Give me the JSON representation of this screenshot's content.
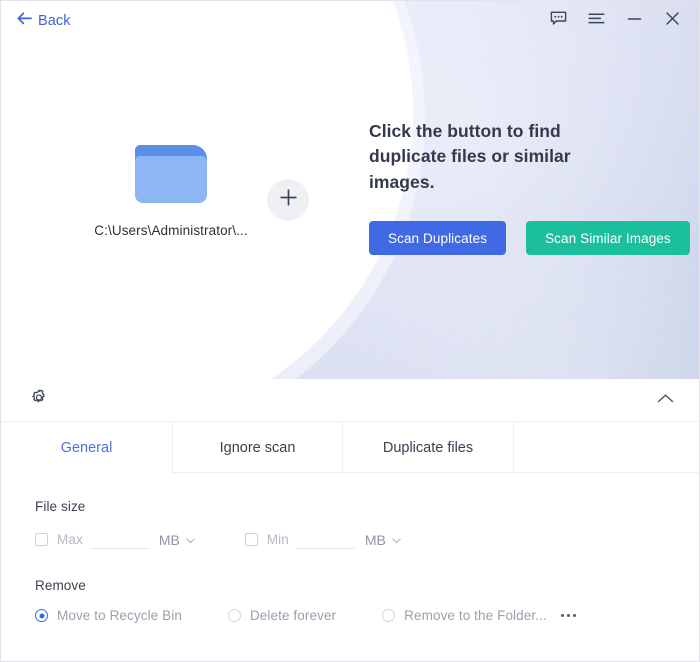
{
  "titlebar": {
    "back_label": "Back",
    "back_icon": "arrow-left-icon",
    "feedback_icon": "feedback-bubble-icon",
    "menu_icon": "hamburger-menu-icon",
    "minimize_icon": "minimize-icon",
    "close_icon": "close-icon"
  },
  "hero": {
    "folder_icon": "folder-icon",
    "folder_path": "C:\\Users\\Administrator\\...",
    "add_icon": "plus-icon",
    "heading": "Click the button to find duplicate files or similar images.",
    "buttons": {
      "scan_duplicates": "Scan Duplicates",
      "scan_similar": "Scan Similar Images"
    },
    "colors": {
      "primary": "#3f6ae4",
      "teal": "#1cbf9b",
      "folder_front": "#8eb6f5",
      "folder_back": "#5a8ee8",
      "background_start": "#eef0fa",
      "background_end": "#c9d2e8"
    }
  },
  "settings": {
    "gear_icon": "gear-icon",
    "collapse_icon": "chevron-up-icon",
    "tabs": [
      {
        "label": "General",
        "active": true
      },
      {
        "label": "Ignore scan",
        "active": false
      },
      {
        "label": "Duplicate files",
        "active": false
      }
    ],
    "file_size": {
      "group_label": "File size",
      "max": {
        "label": "Max",
        "value": "",
        "placeholder": "",
        "unit": "MB",
        "checked": false
      },
      "min": {
        "label": "Min",
        "value": "",
        "placeholder": "",
        "unit": "MB",
        "checked": false
      },
      "unit_caret_icon": "chevron-down-icon"
    },
    "remove": {
      "group_label": "Remove",
      "options": [
        {
          "label": "Move to Recycle Bin",
          "selected": true
        },
        {
          "label": "Delete forever",
          "selected": false
        },
        {
          "label": "Remove to the Folder...",
          "selected": false
        }
      ],
      "more_icon": "ellipsis-icon"
    },
    "active_tab_color": "#4a72e0",
    "selected_radio_color": "#2f6fe4"
  }
}
